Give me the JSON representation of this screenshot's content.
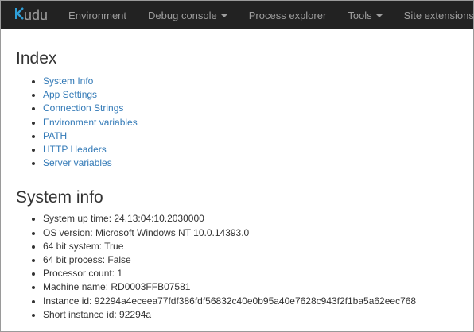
{
  "navbar": {
    "brand": {
      "icon": "kudu-k-logo",
      "text": "udu"
    },
    "items": [
      {
        "label": "Environment",
        "dropdown": false
      },
      {
        "label": "Debug console",
        "dropdown": true
      },
      {
        "label": "Process explorer",
        "dropdown": false
      },
      {
        "label": "Tools",
        "dropdown": true
      },
      {
        "label": "Site extensions",
        "dropdown": false
      }
    ]
  },
  "index": {
    "heading": "Index",
    "links": [
      "System Info",
      "App Settings",
      "Connection Strings",
      "Environment variables",
      "PATH",
      "HTTP Headers",
      "Server variables"
    ]
  },
  "system_info": {
    "heading": "System info",
    "items": [
      "System up time: 24.13:04:10.2030000",
      "OS version: Microsoft Windows NT 10.0.14393.0",
      "64 bit system: True",
      "64 bit process: False",
      "Processor count: 1",
      "Machine name: RD0003FFB07581",
      "Instance id: 92294a4eceea77fdf386fdf56832c40e0b95a40e7628c943f2f1ba5a62eec768",
      "Short instance id: 92294a"
    ]
  },
  "colors": {
    "navbar_bg": "#222222",
    "nav_text": "#9d9d9d",
    "brand_accent": "#2f9fd8",
    "link": "#337ab7"
  }
}
